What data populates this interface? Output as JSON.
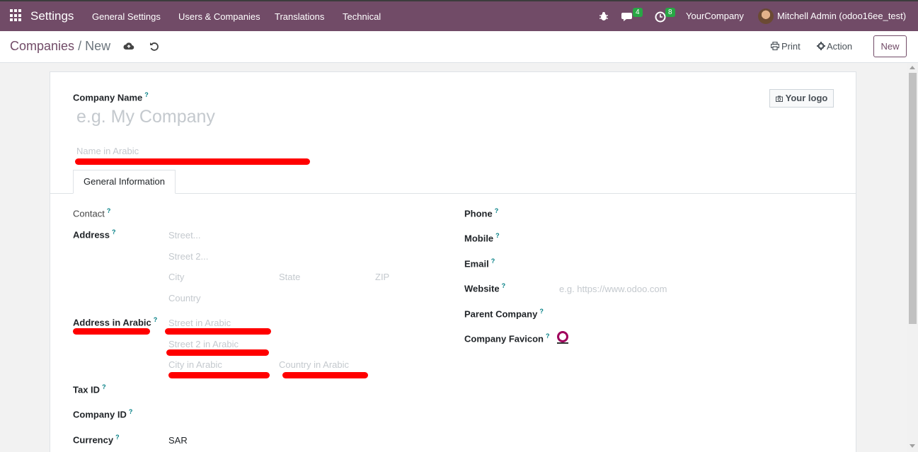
{
  "navbar": {
    "app_title": "Settings",
    "menu": [
      "General Settings",
      "Users & Companies",
      "Translations",
      "Technical"
    ],
    "messages_count": "4",
    "activities_count": "8",
    "company": "YourCompany",
    "user": "Mitchell Admin (odoo16ee_test)"
  },
  "control": {
    "breadcrumb_parent": "Companies",
    "breadcrumb_sep": "/",
    "breadcrumb_current": "New",
    "print_label": "Print",
    "action_label": "Action",
    "new_label": "New"
  },
  "form": {
    "company_name_label": "Company Name",
    "company_name_placeholder": "e.g. My Company",
    "name_arabic_placeholder": "Name in Arabic",
    "logo_label": "Your logo",
    "tab_general": "General Information",
    "help_mark": "?",
    "left": {
      "contact_label": "Contact",
      "address_label": "Address",
      "street_ph": "Street...",
      "street2_ph": "Street 2...",
      "city_ph": "City",
      "state_ph": "State",
      "zip_ph": "ZIP",
      "country_ph": "Country",
      "address_arabic_label": "Address in Arabic",
      "street_arabic_ph": "Street in Arabic",
      "street2_arabic_ph": "Street 2 in Arabic",
      "city_arabic_ph": "City in Arabic",
      "country_arabic_ph": "Country in Arabic",
      "tax_id_label": "Tax ID",
      "company_id_label": "Company ID",
      "currency_label": "Currency",
      "currency_value": "SAR"
    },
    "right": {
      "phone_label": "Phone",
      "mobile_label": "Mobile",
      "email_label": "Email",
      "website_label": "Website",
      "website_ph": "e.g. https://www.odoo.com",
      "parent_company_label": "Parent Company",
      "favicon_label": "Company Favicon"
    }
  },
  "colors": {
    "brand": "#714b67",
    "help": "#017e84",
    "badge": "#28a745",
    "redaction": "#ff0000"
  }
}
